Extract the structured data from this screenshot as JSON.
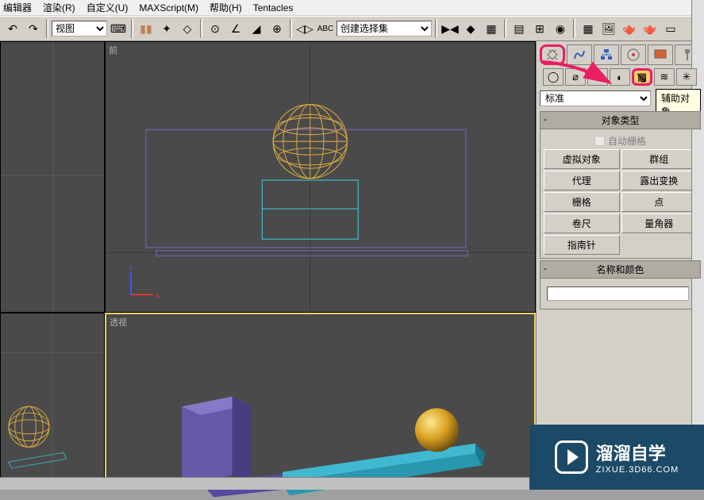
{
  "menu": {
    "editor": "编辑器",
    "render": "渲染(R)",
    "custom": "自定义(U)",
    "maxscript": "MAXScript(M)",
    "help": "帮助(H)",
    "tentacles": "Tentacles"
  },
  "toolbar": {
    "viewport_select": "视图",
    "named_sets": "创建选择集"
  },
  "viewports": {
    "front": "前",
    "perspective": "透视",
    "axis_z": "z",
    "axis_x": "x"
  },
  "cmd_panel": {
    "category_select": "标准",
    "tooltip": "辅助对象",
    "rollout_object_type": "对象类型",
    "auto_grid": "自动栅格",
    "buttons": {
      "dummy": "虚拟对象",
      "crowd": "群组",
      "delegate": "代理",
      "expose_tm": "露出变换",
      "grid": "栅格",
      "point": "点",
      "tape": "卷尺",
      "protractor": "量角器",
      "compass": "指南针"
    },
    "rollout_name_color": "名称和颜色"
  },
  "watermark": {
    "cn": "溜溜自学",
    "en": "ZIXUE.3D66.COM"
  }
}
